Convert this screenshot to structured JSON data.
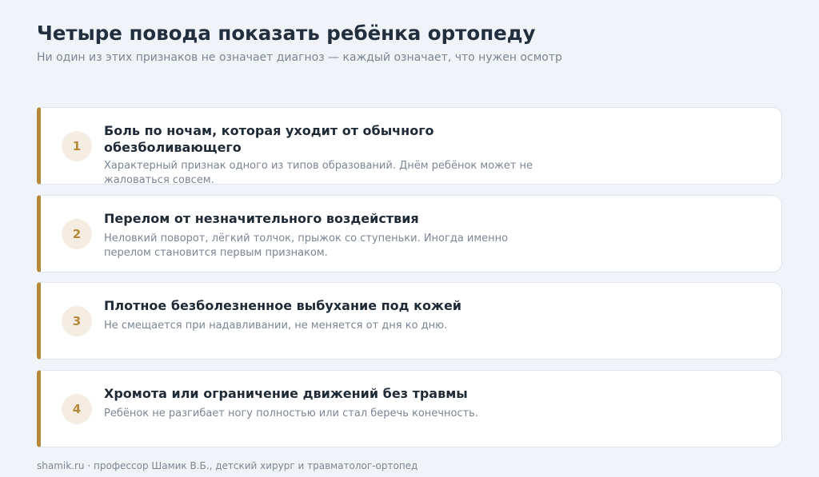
{
  "header": {
    "title": "Четыре повода показать ребёнка ортопеду",
    "subtitle": "Ни один из этих признаков не означает диагноз — каждый означает, что нужен осмотр"
  },
  "items": [
    {
      "number": "1",
      "title": "Боль по ночам, которая уходит от обычного обезболивающего",
      "description": "Характерный признак одного из типов образований. Днём ребёнок может не жаловаться совсем."
    },
    {
      "number": "2",
      "title": "Перелом от незначительного воздействия",
      "description": "Неловкий поворот, лёгкий толчок, прыжок со ступеньки. Иногда именно перелом становится первым признаком."
    },
    {
      "number": "3",
      "title": "Плотное безболезненное выбухание под кожей",
      "description": "Не смещается при надавливании, не меняется от дня ко дню."
    },
    {
      "number": "4",
      "title": "Хромота или ограничение движений без травмы",
      "description": "Ребёнок не разгибает ногу полностью или стал беречь конечность."
    }
  ],
  "footer": {
    "text": "shamik.ru · профессор Шамик В.Б., детский хирург и травматолог-ортопед"
  },
  "colors": {
    "accent": "#b5883a",
    "badge_bg": "#f6ede2",
    "background": "#f0f4f8"
  }
}
